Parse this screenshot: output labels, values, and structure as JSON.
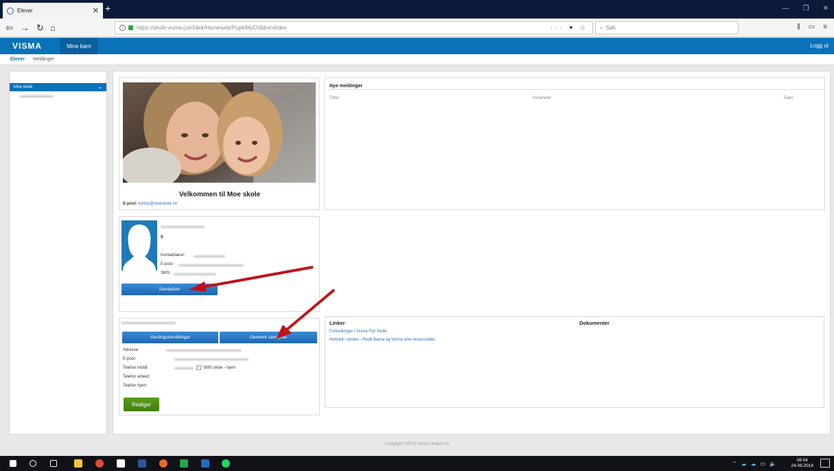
{
  "browser": {
    "tab_title": "Elever",
    "url": "https://skole.visma.com/dek/Homeweb/Pupil/MyChildrenIndex",
    "search_placeholder": "Søk"
  },
  "header": {
    "logo": "VISMA",
    "nav_item": "Mine barn",
    "logout": "Logg ut"
  },
  "subnav": {
    "active": "Elever",
    "link": "Meldinger"
  },
  "sidebar": {
    "school_selected": "Moe skole"
  },
  "school_card": {
    "welcome": "Velkommen til Moe skole",
    "email_label": "E-post:",
    "email_value": "kontor@moeskole.no"
  },
  "pupil_card": {
    "grade": "9",
    "contact_teacher_label": "Kontaktlærer:",
    "email_label": "E-post:",
    "sms_label": "SMS:",
    "consent_button": "Samtykker"
  },
  "guardian_card": {
    "notify_button": "Varslingsinnstillinger",
    "general_consent_button": "Generelt samtykke",
    "address_label": "Adresse:",
    "email_label": "E-post:",
    "mobile_label": "Telefon mobil:",
    "sms_checkbox": "SMS skole - hjem",
    "work_label": "Telefon arbeid:",
    "home_label": "Telefon hjem:",
    "edit_button": "Rediger"
  },
  "messages": {
    "title": "Nye meldinger",
    "col_title": "Tittel",
    "col_sender": "Avsender",
    "col_date": "Dato"
  },
  "links": {
    "links_title": "Linker",
    "docs_title": "Dokumenter",
    "items": [
      "Forbedringer i Visma Flyt Skole",
      "Nettvett i skolen - Redd Barna og Visma sine ressurssider"
    ]
  },
  "footer": {
    "copyright": "Copyright ©2013 Visma Unique AS"
  },
  "taskbar": {
    "time": "08:54",
    "date": "24.08.2018"
  }
}
